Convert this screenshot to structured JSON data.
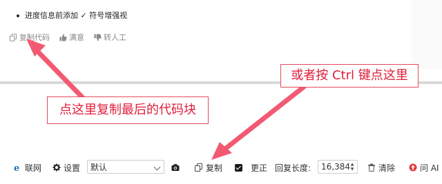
{
  "message": {
    "bullet_text": "进度信息前添加 ✓ 符号增强视",
    "actions": [
      {
        "icon": "copy-icon",
        "label": "复制代码"
      },
      {
        "icon": "thumbs-up-icon",
        "label": "满意"
      },
      {
        "icon": "thumbs-down-icon",
        "label": "转人工"
      }
    ]
  },
  "callouts": {
    "shortcut_hint": "或者按 Ctrl 键点这里",
    "copy_hint": "点这里复制最后的代码块"
  },
  "toolbar": {
    "network_label": "联网",
    "settings_label": "设置",
    "model_select_value": "默认",
    "copy_label": "复制",
    "correct_label": "更正",
    "reply_length_label": "回复长度:",
    "reply_length_value": "16,384",
    "clear_label": "清除",
    "ask_ai_label": "问 AI"
  },
  "colors": {
    "accent_red": "#e11d3a",
    "ie_blue": "#1e73be",
    "ask_red": "#e23b3b"
  }
}
